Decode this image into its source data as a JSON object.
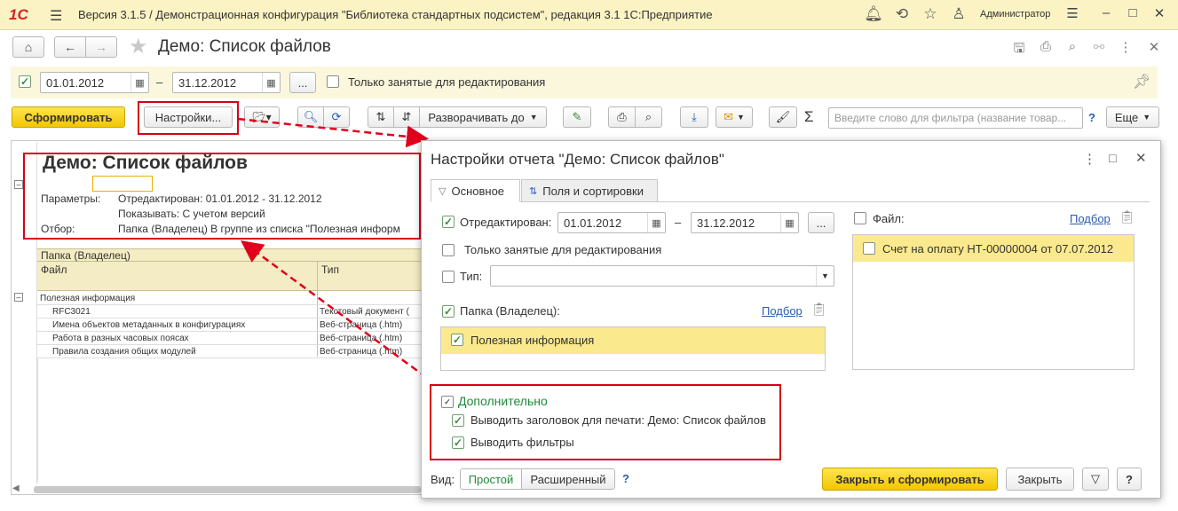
{
  "app": {
    "logo": "1С",
    "title": "Версия 3.1.5 / Демонстрационная конфигурация \"Библиотека стандартных подсистем\", редакция 3.1 1С:Предприятие",
    "user": "Администратор"
  },
  "page": {
    "title": "Демо: Список файлов"
  },
  "params": {
    "date_from": "01.01.2012",
    "dash": "–",
    "date_to": "31.12.2012",
    "ellipsis": "...",
    "only_busy_label": "Только занятые для редактирования"
  },
  "toolbar": {
    "generate_label": "Сформировать",
    "settings_label": "Настройки...",
    "expand_label": "Разворачивать до",
    "search_placeholder": "Введите слово для фильтра (название товар...",
    "help": "?",
    "more_label": "Еще"
  },
  "report": {
    "title": "Демо: Список файлов",
    "params_label": "Параметры:",
    "params_value1": "Отредактирован: 01.01.2012 - 31.12.2012",
    "params_value2": "Показывать: С учетом версий",
    "filter_label": "Отбор:",
    "filter_value": "Папка (Владелец) В группе из списка \"Полезная информ",
    "col_folder": "Папка (Владелец)",
    "col_file": "Файл",
    "col_type": "Тип",
    "group_name": "Полезная информация",
    "rows": [
      {
        "file": "RFC3021",
        "type": "Текстовый документ ("
      },
      {
        "file": "Имена объектов метаданных в конфигурациях",
        "type": "Веб-страница (.htm)"
      },
      {
        "file": "Работа в разных часовых поясах",
        "type": "Веб-страница (.htm)"
      },
      {
        "file": "Правила создания общих модулей",
        "type": "Веб-страница (.htm)"
      }
    ]
  },
  "dialog": {
    "title": "Настройки отчета \"Демо: Список файлов\"",
    "tab_main": "Основное",
    "tab_fields": "Поля и сортировки",
    "edited_label": "Отредактирован:",
    "date_from": "01.01.2012",
    "dash": "–",
    "date_to": "31.12.2012",
    "ellipsis": "...",
    "only_busy_label": "Только занятые для редактирования",
    "type_label": "Тип:",
    "folder_label": "Папка (Владелец):",
    "pick_link": "Подбор",
    "folder_item": "Полезная информация",
    "file_label": "Файл:",
    "file_pick_link": "Подбор",
    "file_item": "Счет на оплату НТ-00000004 от 07.07.2012",
    "extra_section": "Дополнительно",
    "print_header_label": "Выводить заголовок для печати: Демо: Список файлов",
    "print_filters_label": "Выводить фильтры",
    "view_label": "Вид:",
    "view_simple": "Простой",
    "view_extended": "Расширенный",
    "help": "?",
    "close_generate_label": "Закрыть и сформировать",
    "close_label": "Закрыть",
    "help2": "?"
  }
}
